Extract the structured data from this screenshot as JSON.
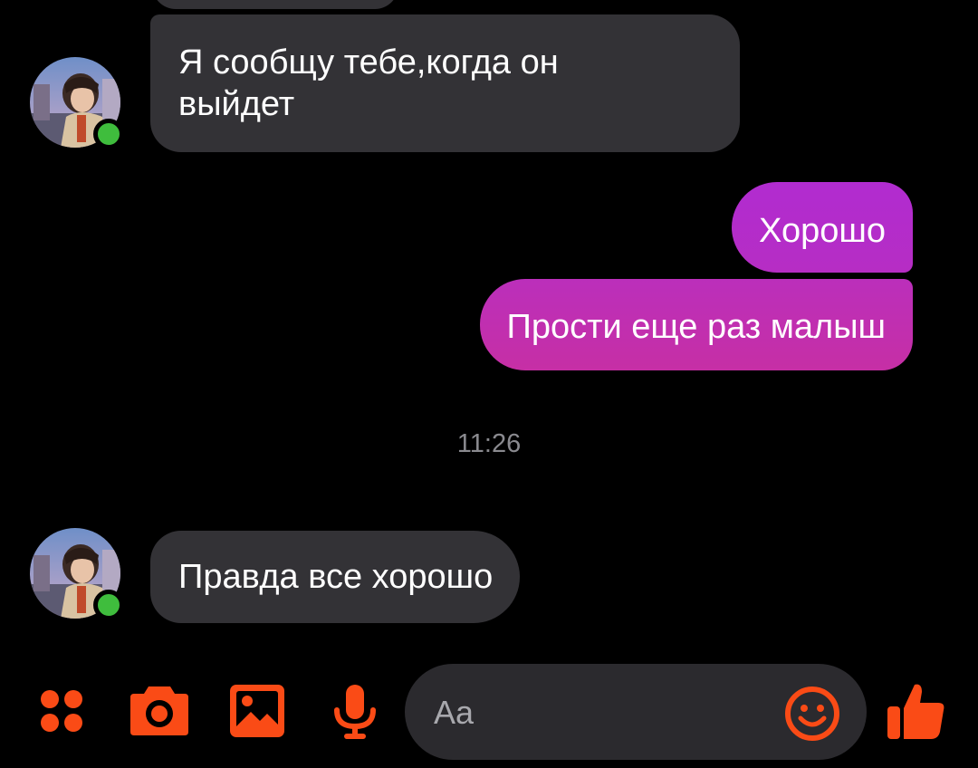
{
  "conversation": {
    "messages": [
      {
        "direction": "incoming",
        "text": "Я сообщу тебе,когда он выйдет",
        "line1": "Я сообщу тебе,когда он",
        "line2": "выйдет"
      },
      {
        "direction": "outgoing",
        "text": "Хорошо"
      },
      {
        "direction": "outgoing",
        "text": "Прости еще раз малыш"
      },
      {
        "direction": "incoming",
        "text": "Правда все хорошо"
      }
    ],
    "timestamp": "11:26",
    "contact_online": true
  },
  "composer": {
    "placeholder": "Aa",
    "value": "",
    "icons": [
      "menu-dots-icon",
      "camera-icon",
      "image-icon",
      "microphone-icon",
      "emoji-icon",
      "thumbs-up-icon"
    ]
  },
  "theme": {
    "accent": "#fa4b16",
    "incoming_bubble": "#333236",
    "outgoing_gradient_start": "#b12cd0",
    "outgoing_gradient_end": "#c62fa5",
    "online": "#3fbd3d",
    "background": "#000000"
  }
}
